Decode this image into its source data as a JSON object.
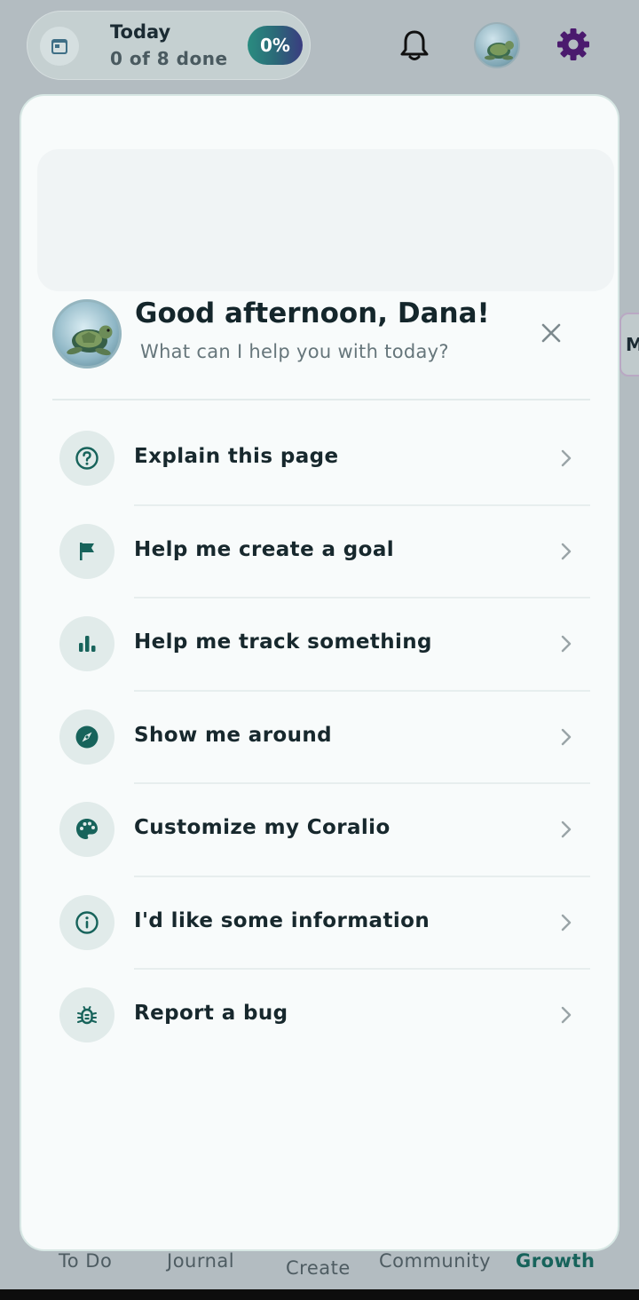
{
  "topbar": {
    "today_title": "Today",
    "today_sub": "0 of 8 done",
    "progress_label": "0%",
    "progress_value": 0
  },
  "side_tab_label": "M",
  "panel": {
    "greeting": "Good afternoon, Dana!",
    "subtitle": "What can I help you with today?",
    "items": [
      {
        "label": "Explain this page",
        "icon": "question-circle-icon"
      },
      {
        "label": "Help me create a goal",
        "icon": "flag-icon"
      },
      {
        "label": "Help me track something",
        "icon": "bar-chart-icon"
      },
      {
        "label": "Show me around",
        "icon": "compass-icon"
      },
      {
        "label": "Customize my Coralio",
        "icon": "palette-icon"
      },
      {
        "label": "I'd like some information",
        "icon": "info-circle-icon"
      },
      {
        "label": "Report a bug",
        "icon": "bug-icon"
      }
    ]
  },
  "bottom_nav": {
    "items": [
      {
        "label": "To Do"
      },
      {
        "label": "Journal"
      },
      {
        "label": "Create"
      },
      {
        "label": "Community"
      },
      {
        "label": "Growth",
        "active": true
      }
    ]
  },
  "colors": {
    "accent": "#17635b",
    "icon_bg": "#e1ebea",
    "settings": "#4b1a6e"
  }
}
